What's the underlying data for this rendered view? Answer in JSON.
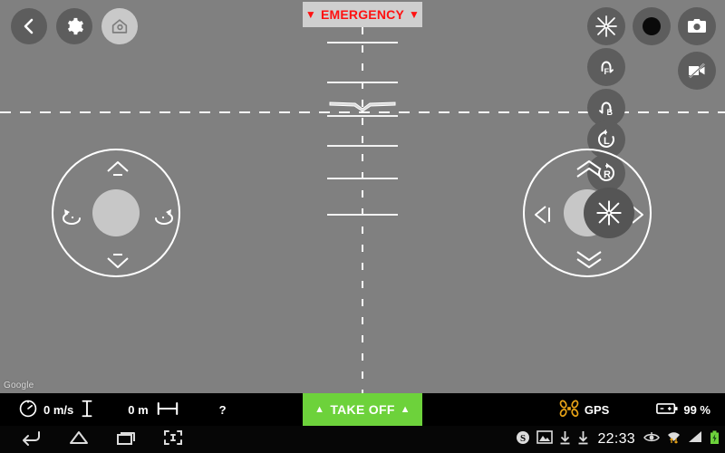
{
  "app": {
    "name": "drone-ground-control",
    "background_color": "#808080"
  },
  "map": {
    "attribution": "Google"
  },
  "topbar": {
    "back_label": "Back",
    "settings_label": "Settings",
    "home_label": "Return Home"
  },
  "emergency": {
    "label": "EMERGENCY",
    "left_marker": "▼",
    "right_marker": "▼",
    "text_color": "#ff1111",
    "background_color": "#cfcfcf"
  },
  "takeoff": {
    "label": "TAKE OFF",
    "left_marker": "▲",
    "right_marker": "▲",
    "background_color": "#6dd23b",
    "text_color": "#ffffff"
  },
  "right_controls": [
    {
      "name": "propeller-toggle-icon",
      "label": ""
    },
    {
      "name": "record-button",
      "label": ""
    },
    {
      "name": "camera-snapshot-icon",
      "label": ""
    },
    {
      "name": "flip-forward-icon",
      "label": "F"
    },
    {
      "name": "flip-backward-icon",
      "label": "B"
    },
    {
      "name": "rotate-left-icon",
      "label": "L"
    },
    {
      "name": "rotate-right-icon",
      "label": "R"
    },
    {
      "name": "video-off-icon",
      "label": ""
    }
  ],
  "left_stick": {
    "up_label": "Ascend",
    "down_label": "Descend",
    "left_label": "Yaw Left",
    "right_label": "Yaw Right"
  },
  "right_stick": {
    "up_label": "Forward",
    "down_label": "Backward",
    "left_label": "Left",
    "right_label": "Right"
  },
  "telemetry": {
    "speed_value": "0 m/s",
    "altitude_value": "0 m",
    "distance_value": "?",
    "gps_label": "GPS",
    "battery_value": "99 %",
    "speed_icon": "speedometer-icon",
    "vertical_speed_icon": "vertical-speed-icon",
    "distance_icon": "distance-icon",
    "gps_icon": "quadcopter-icon",
    "battery_icon": "battery-icon"
  },
  "android": {
    "clock": "22:33",
    "nav": [
      {
        "name": "nav-back-icon"
      },
      {
        "name": "nav-home-icon"
      },
      {
        "name": "nav-recents-icon"
      },
      {
        "name": "nav-screenshot-icon"
      }
    ],
    "status": [
      {
        "name": "skype-icon"
      },
      {
        "name": "screenshot-image-icon"
      },
      {
        "name": "download-icon"
      },
      {
        "name": "download-icon"
      },
      {
        "name": "eye-icon"
      },
      {
        "name": "wifi-icon"
      },
      {
        "name": "signal-icon"
      },
      {
        "name": "battery-icon"
      }
    ]
  },
  "hud": {
    "pitch_bars_y": [
      46,
      90,
      127,
      160,
      196,
      236
    ],
    "aircraft_symbol": "attitude-indicator"
  }
}
